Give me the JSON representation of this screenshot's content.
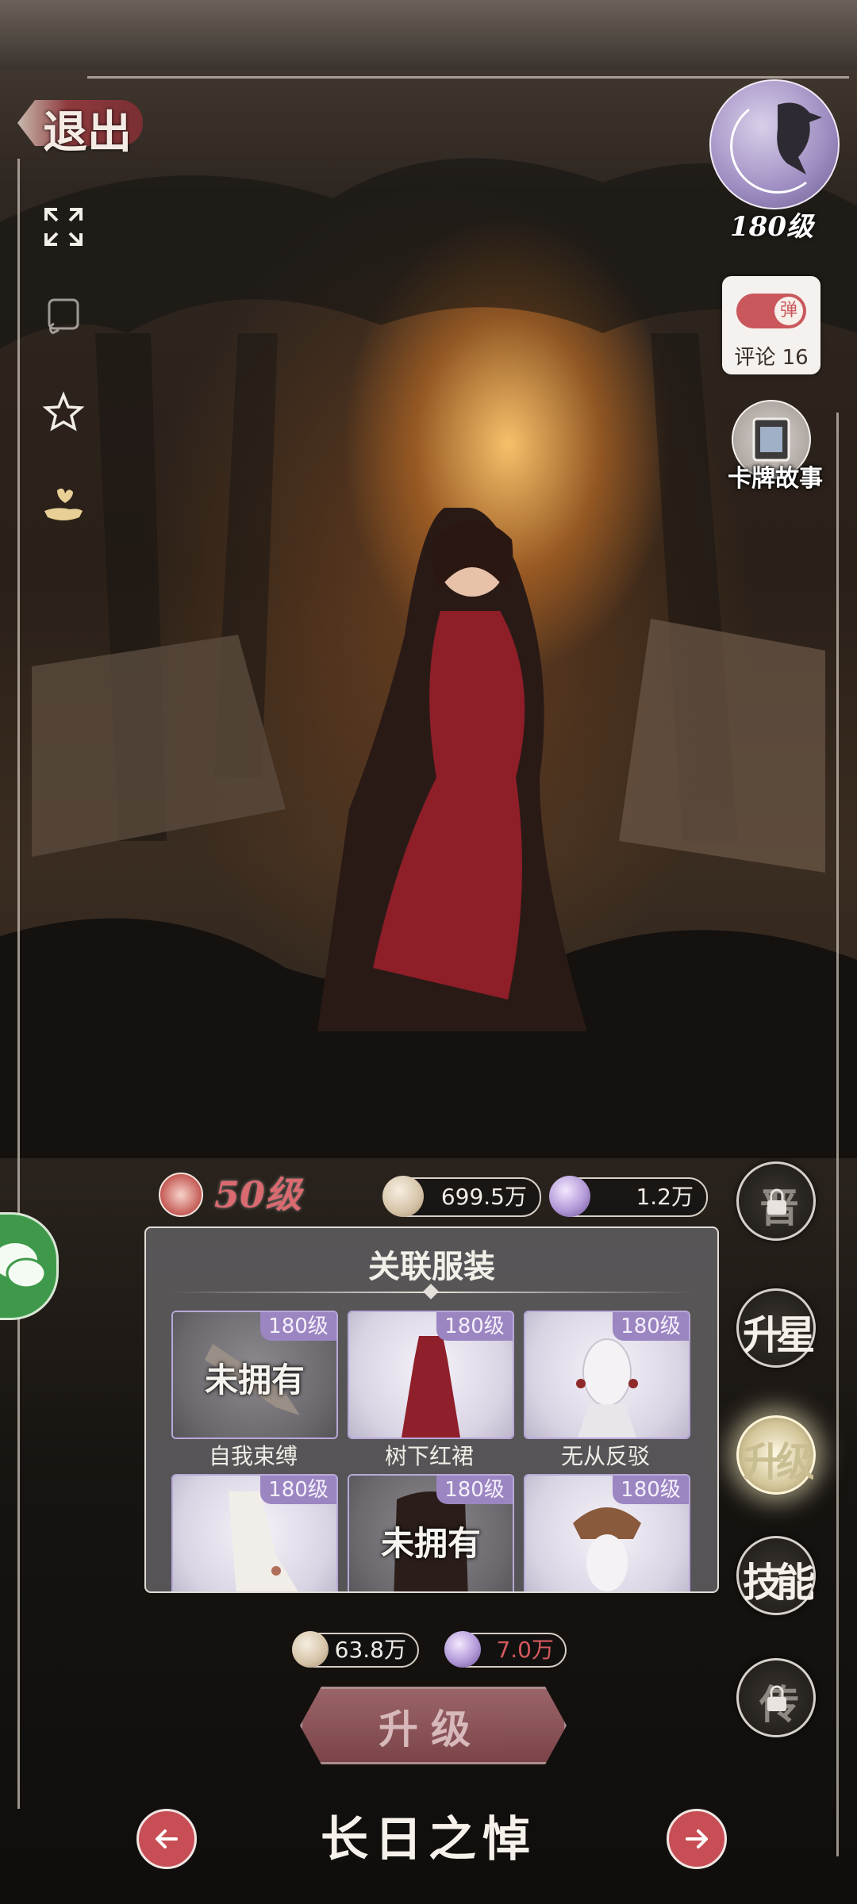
{
  "header": {
    "exit_label": "退出"
  },
  "player": {
    "level_label": "180级"
  },
  "danmaku": {
    "toggle_label": "弹",
    "comment_label": "评论 16"
  },
  "card_story_label": "卡牌故事",
  "card": {
    "level_label": "50级",
    "name": "长日之悼"
  },
  "currencies": {
    "coins": "699.5万",
    "gems": "1.2万"
  },
  "right_menu": {
    "locked_top": "晋",
    "star_up": "升星",
    "upgrade": "升级",
    "skill": "技能",
    "locked_bottom": "传"
  },
  "related_outfits": {
    "title": "关联服装",
    "items": [
      {
        "name": "自我束缚",
        "level": "180级",
        "owned": false,
        "status": "未拥有"
      },
      {
        "name": "树下红裙",
        "level": "180级",
        "owned": true,
        "status": ""
      },
      {
        "name": "无从反驳",
        "level": "180级",
        "owned": true,
        "status": ""
      },
      {
        "name": "",
        "level": "180级",
        "owned": true,
        "status": ""
      },
      {
        "name": "",
        "level": "180级",
        "owned": false,
        "status": "未拥有"
      },
      {
        "name": "",
        "level": "180级",
        "owned": true,
        "status": ""
      }
    ]
  },
  "upgrade_cost": {
    "coins": "63.8万",
    "gems": "7.0万"
  },
  "upgrade_button": "升级",
  "colors": {
    "accent_red": "#c84e56",
    "level_purple": "#9b86c2",
    "insufficient": "#d55a5e"
  }
}
